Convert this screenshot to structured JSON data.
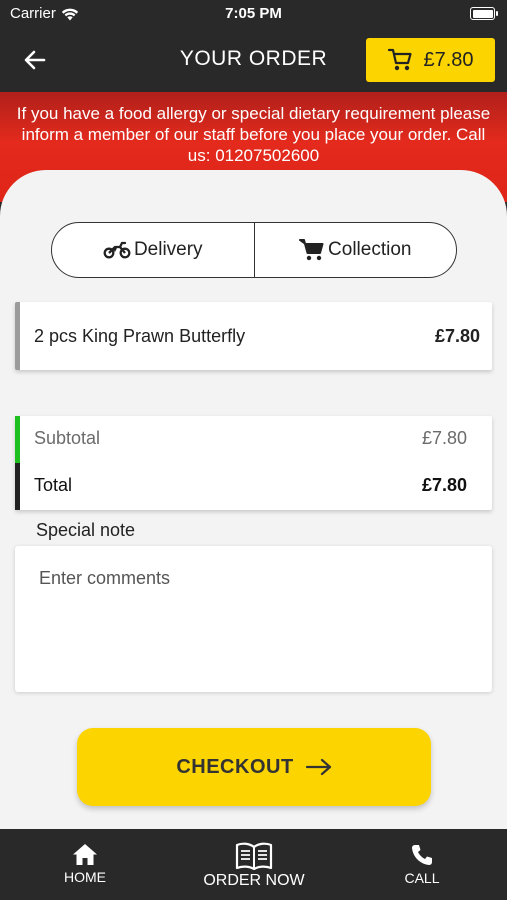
{
  "status_bar": {
    "carrier": "Carrier",
    "time": "7:05 PM"
  },
  "header": {
    "title": "YOUR ORDER",
    "cart_total": "£7.80"
  },
  "notice": "If you have a food allergy or special dietary requirement please inform a member of our staff before you place your order. Call us: 01207502600",
  "order_mode": {
    "options": [
      "Delivery",
      "Collection"
    ]
  },
  "items": [
    {
      "name": "2 pcs King Prawn Butterfly",
      "price": "£7.80"
    }
  ],
  "totals": {
    "subtotal_label": "Subtotal",
    "subtotal_value": "£7.80",
    "total_label": "Total",
    "total_value": "£7.80"
  },
  "note": {
    "label": "Special note",
    "placeholder": "Enter comments"
  },
  "checkout": {
    "label": "CHECKOUT"
  },
  "tab_bar": {
    "home": "HOME",
    "order_now": "ORDER NOW",
    "call": "CALL"
  },
  "colors": {
    "accent": "#fcd400",
    "dark": "#2a2929",
    "banner_red": "#e32a1d",
    "subtotal_green": "#1fbf1f"
  }
}
